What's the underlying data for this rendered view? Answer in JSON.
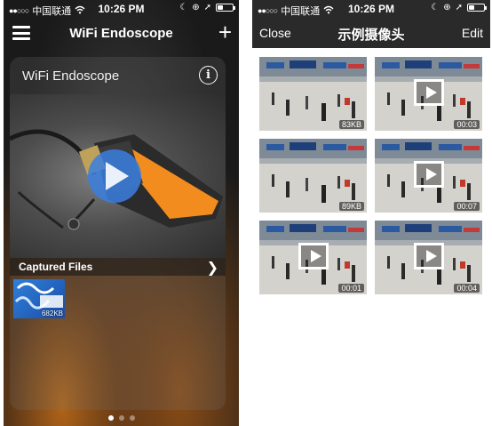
{
  "left": {
    "status": {
      "carrier": "中国联通",
      "time": "10:26 PM",
      "battery_level": 0.35
    },
    "nav": {
      "title": "WiFi Endoscope"
    },
    "card": {
      "title": "WiFi Endoscope"
    },
    "captured": {
      "label": "Captured Files"
    },
    "files": [
      {
        "size": "682KB"
      }
    ],
    "page_indicator": {
      "count": 3,
      "active": 0
    }
  },
  "right": {
    "status": {
      "carrier": "中国联通",
      "time": "10:26 PM",
      "battery_level": 0.35
    },
    "nav": {
      "close_label": "Close",
      "title": "示例摄像头",
      "edit_label": "Edit"
    },
    "items": [
      {
        "type": "photo",
        "label": "83KB"
      },
      {
        "type": "video",
        "label": "00:03"
      },
      {
        "type": "photo",
        "label": "89KB"
      },
      {
        "type": "video",
        "label": "00:07"
      },
      {
        "type": "video",
        "label": "00:01"
      },
      {
        "type": "video",
        "label": "00:04"
      }
    ]
  },
  "colors": {
    "accent_orange": "#f28c1e",
    "play_blue": "#3a7fe0",
    "nav_dark": "#2a2a2a"
  }
}
